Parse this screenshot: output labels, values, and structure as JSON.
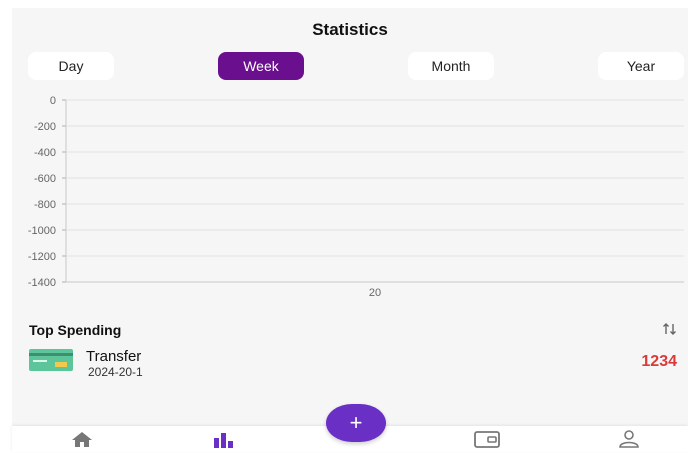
{
  "header": {
    "title": "Statistics"
  },
  "periods": [
    {
      "label": "Day"
    },
    {
      "label": "Week"
    },
    {
      "label": "Month"
    },
    {
      "label": "Year"
    }
  ],
  "active_period": "Week",
  "chart_data": {
    "type": "bar",
    "categories": [
      "20"
    ],
    "values": [
      0
    ],
    "yticks": [
      "0",
      "-200",
      "-400",
      "-600",
      "-800",
      "-1000",
      "-1200",
      "-1400"
    ],
    "ylim": [
      -1400,
      0
    ],
    "grid": true
  },
  "top_spending": {
    "title": "Top Spending",
    "sort_icon": "sort-arrows-icon",
    "items": [
      {
        "name": "Transfer",
        "date": "2024-20-1",
        "amount": "1234",
        "icon": "credit-card-icon",
        "amount_color": "#d93a3a"
      }
    ]
  },
  "nav": {
    "items": [
      "home-icon",
      "stats-icon",
      "wallet-icon",
      "profile-icon"
    ],
    "fab_label": "+",
    "accent": "#6a2fc4"
  }
}
